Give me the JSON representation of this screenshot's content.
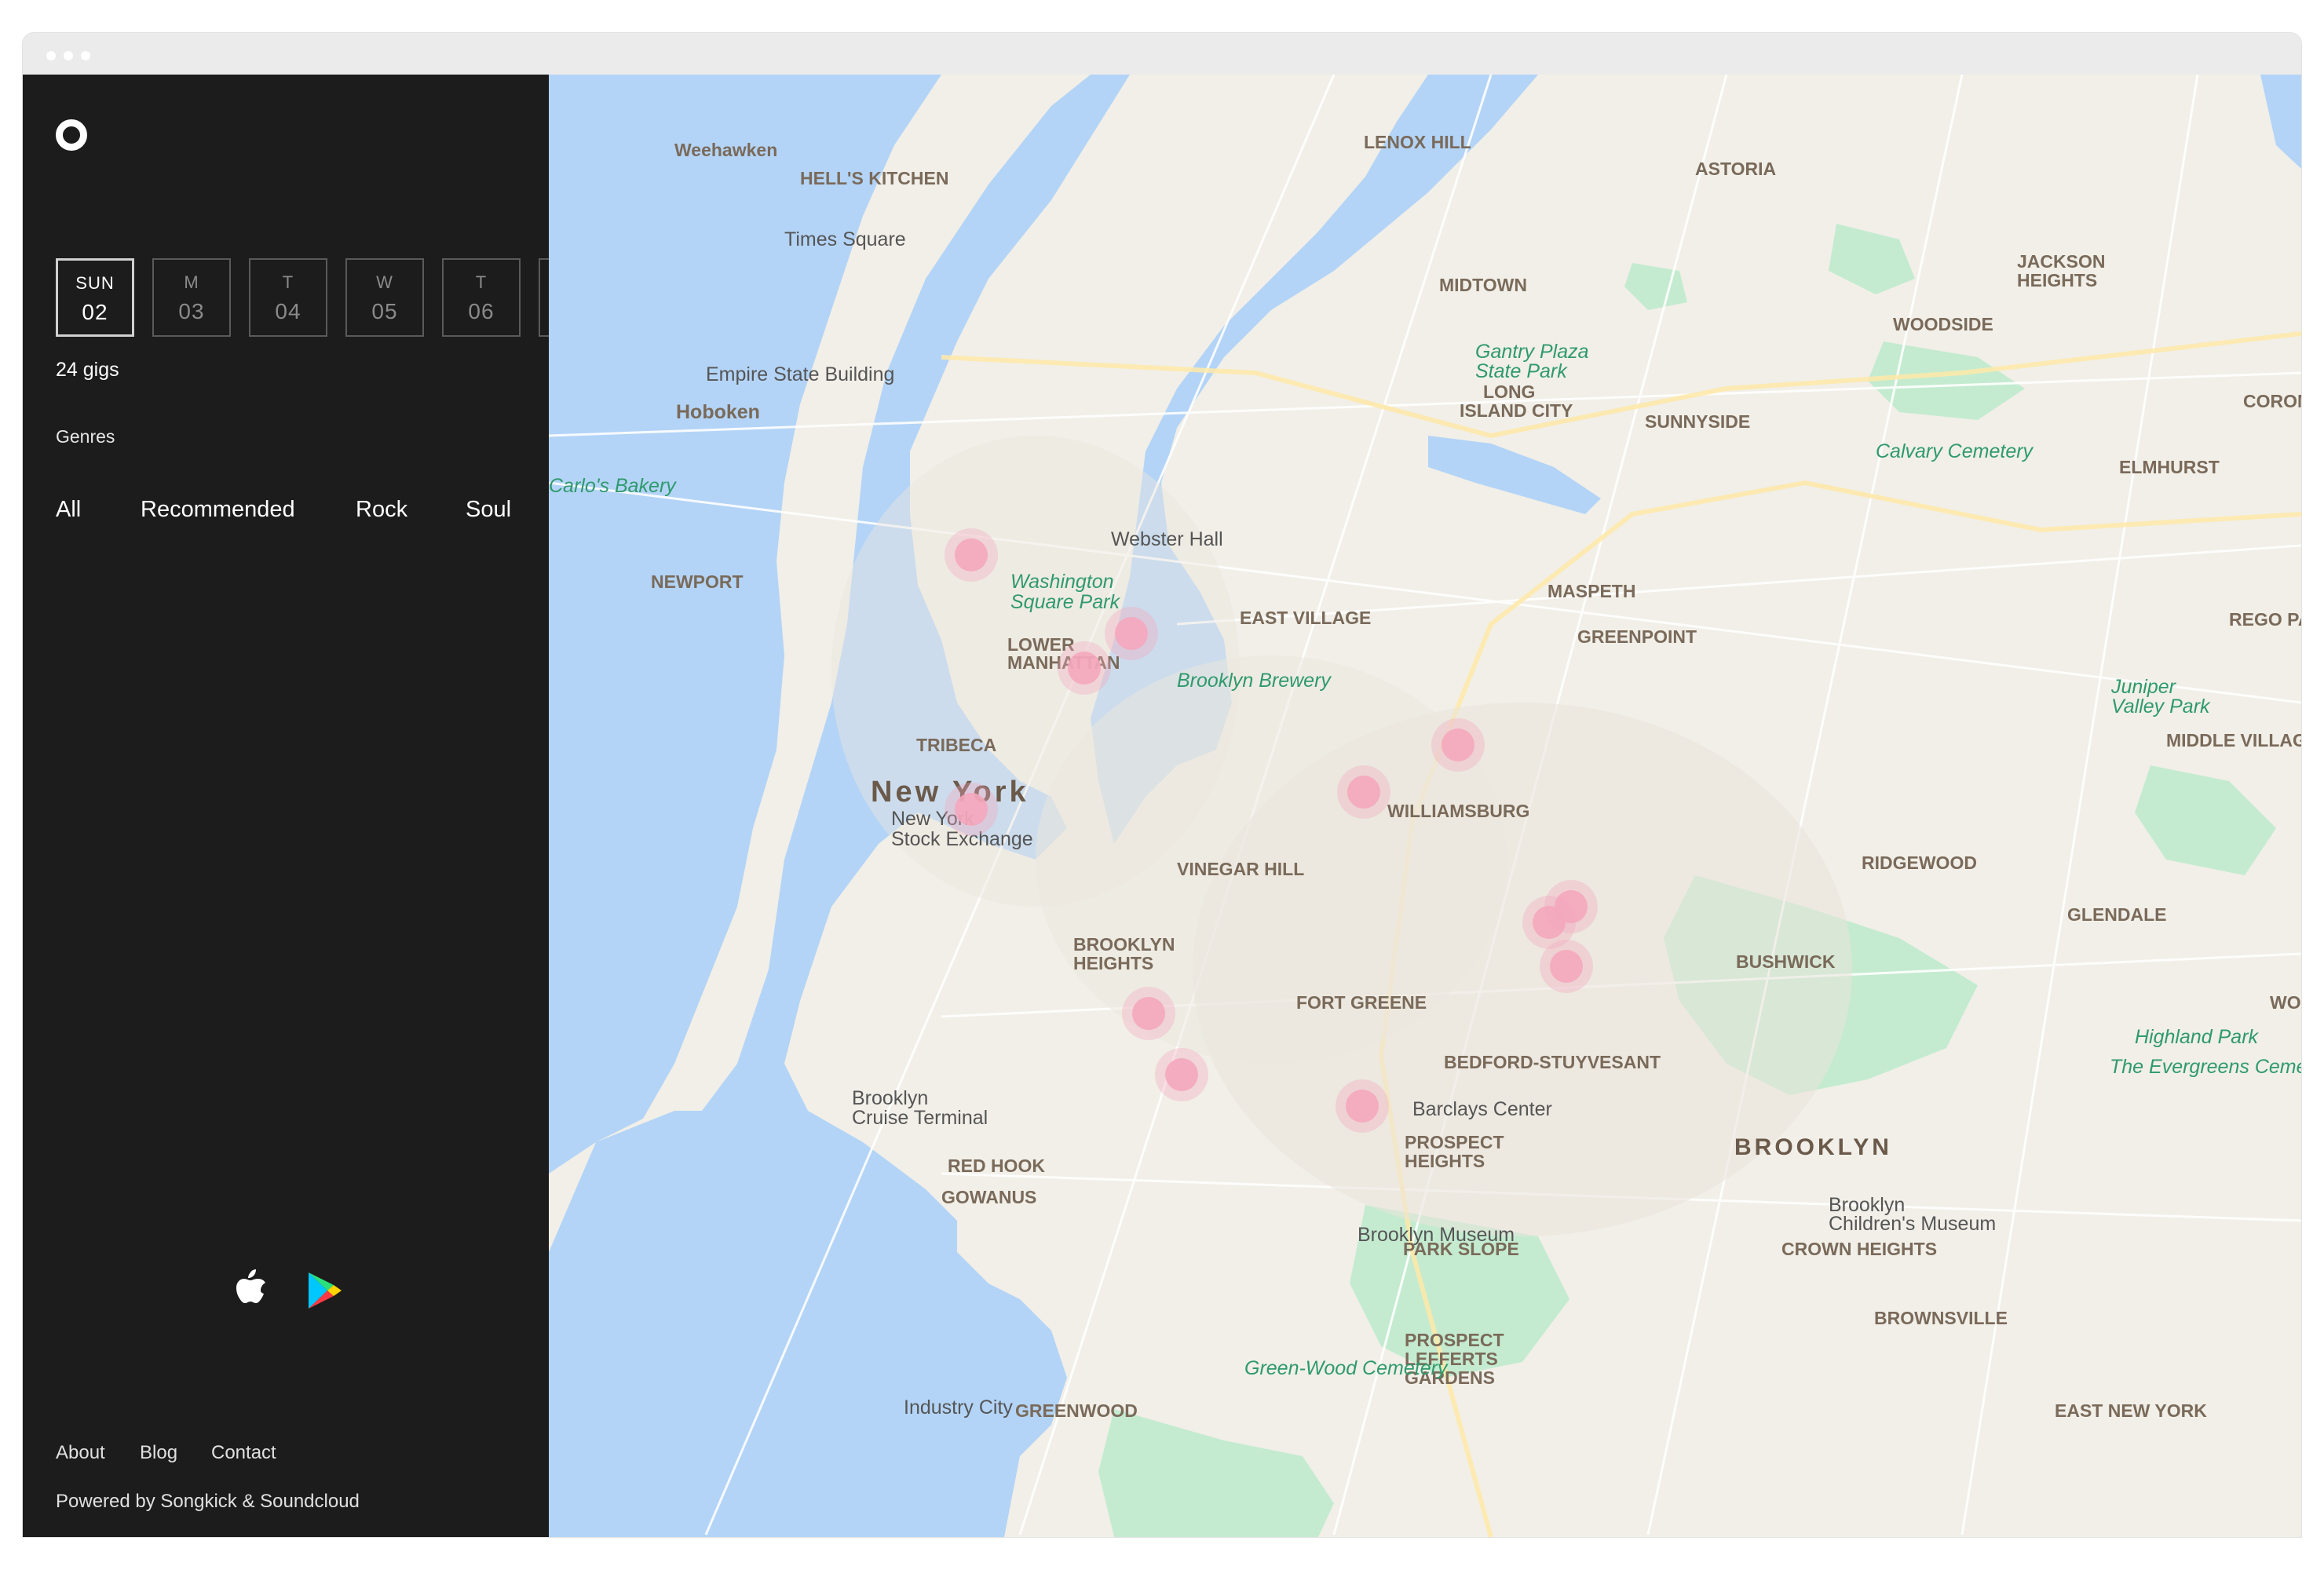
{
  "window": {
    "title": ""
  },
  "sidebar": {
    "days": [
      {
        "name": "SUN",
        "date": "02",
        "active": true
      },
      {
        "name": "M",
        "date": "03",
        "active": false
      },
      {
        "name": "T",
        "date": "04",
        "active": false
      },
      {
        "name": "W",
        "date": "05",
        "active": false
      },
      {
        "name": "T",
        "date": "06",
        "active": false
      }
    ],
    "gig_count": "24 gigs",
    "genres_label": "Genres",
    "genres": [
      "All",
      "Recommended",
      "Rock",
      "Soul"
    ],
    "footer_links": [
      "About",
      "Blog",
      "Contact"
    ],
    "powered_by": "Powered by Songkick & Soundcloud"
  },
  "map": {
    "colors": {
      "water": "#b3d4f7",
      "land": "#f1efe8",
      "park": "#c4ebd0",
      "marker": "#f4a7bd",
      "sidebar": "#1c1c1c"
    },
    "labels": [
      {
        "text": "Weehawken",
        "kind": "area"
      },
      {
        "text": "HELL'S KITCHEN",
        "kind": "area"
      },
      {
        "text": "LENOX HILL",
        "kind": "area"
      },
      {
        "text": "ASTORIA",
        "kind": "area"
      },
      {
        "text": "Times Square",
        "kind": "poi"
      },
      {
        "text": "MIDTOWN",
        "kind": "area"
      },
      {
        "text": "JACKSON",
        "kind": "area"
      },
      {
        "text": "HEIGHTS",
        "kind": "area"
      },
      {
        "text": "WOODSIDE",
        "kind": "area"
      },
      {
        "text": "Empire State Building",
        "kind": "poi"
      },
      {
        "text": "Gantry Plaza",
        "kind": "park"
      },
      {
        "text": "State Park",
        "kind": "park"
      },
      {
        "text": "LONG",
        "kind": "area"
      },
      {
        "text": "ISLAND CITY",
        "kind": "area"
      },
      {
        "text": "SUNNYSIDE",
        "kind": "area"
      },
      {
        "text": "CORONA",
        "kind": "area"
      },
      {
        "text": "Hoboken",
        "kind": "area"
      },
      {
        "text": "Calvary Cemetery",
        "kind": "park"
      },
      {
        "text": "ELMHURST",
        "kind": "area"
      },
      {
        "text": "Carlo's Bakery",
        "kind": "park"
      },
      {
        "text": "Webster Hall",
        "kind": "poi"
      },
      {
        "text": "Washington",
        "kind": "park"
      },
      {
        "text": "Square Park",
        "kind": "park"
      },
      {
        "text": "NEWPORT",
        "kind": "area"
      },
      {
        "text": "MASPETH",
        "kind": "area"
      },
      {
        "text": "EAST VILLAGE",
        "kind": "area"
      },
      {
        "text": "REGO PAR",
        "kind": "area"
      },
      {
        "text": "GREENPOINT",
        "kind": "area"
      },
      {
        "text": "LOWER",
        "kind": "area"
      },
      {
        "text": "MANHATTAN",
        "kind": "area"
      },
      {
        "text": "Brooklyn Brewery",
        "kind": "park"
      },
      {
        "text": "Juniper",
        "kind": "park"
      },
      {
        "text": "Valley Park",
        "kind": "park"
      },
      {
        "text": "MIDDLE VILLAGE",
        "kind": "area"
      },
      {
        "text": "TRIBECA",
        "kind": "area"
      },
      {
        "text": "New York",
        "kind": "city"
      },
      {
        "text": "WILLIAMSBURG",
        "kind": "area"
      },
      {
        "text": "New York",
        "kind": "poi"
      },
      {
        "text": "Stock Exchange",
        "kind": "poi"
      },
      {
        "text": "RIDGEWOOD",
        "kind": "area"
      },
      {
        "text": "VINEGAR HILL",
        "kind": "area"
      },
      {
        "text": "GLENDALE",
        "kind": "area"
      },
      {
        "text": "BROOKLYN",
        "kind": "area"
      },
      {
        "text": "HEIGHTS",
        "kind": "area"
      },
      {
        "text": "BUSHWICK",
        "kind": "area"
      },
      {
        "text": "FORT GREENE",
        "kind": "area"
      },
      {
        "text": "WOO",
        "kind": "area"
      },
      {
        "text": "Highland Park",
        "kind": "park"
      },
      {
        "text": "BEDFORD-STUYVESANT",
        "kind": "area"
      },
      {
        "text": "The Evergreens Cemetery",
        "kind": "park"
      },
      {
        "text": "Brooklyn",
        "kind": "poi"
      },
      {
        "text": "Cruise Terminal",
        "kind": "poi"
      },
      {
        "text": "Barclays Center",
        "kind": "poi"
      },
      {
        "text": "PROSPECT",
        "kind": "area"
      },
      {
        "text": "HEIGHTS",
        "kind": "area"
      },
      {
        "text": "BROOKLYN",
        "kind": "borough"
      },
      {
        "text": "RED HOOK",
        "kind": "area"
      },
      {
        "text": "Brooklyn",
        "kind": "poi"
      },
      {
        "text": "Children's Museum",
        "kind": "poi"
      },
      {
        "text": "GOWANUS",
        "kind": "area"
      },
      {
        "text": "Brooklyn Museum",
        "kind": "poi"
      },
      {
        "text": "PARK SLOPE",
        "kind": "area"
      },
      {
        "text": "CROWN HEIGHTS",
        "kind": "area"
      },
      {
        "text": "BROWNSVILLE",
        "kind": "area"
      },
      {
        "text": "PROSPECT",
        "kind": "area"
      },
      {
        "text": "LEFFERTS",
        "kind": "area"
      },
      {
        "text": "GARDENS",
        "kind": "area"
      },
      {
        "text": "Green-Wood Cemetery",
        "kind": "park"
      },
      {
        "text": "EAST NEW YORK",
        "kind": "area"
      },
      {
        "text": "Industry City",
        "kind": "poi"
      },
      {
        "text": "GREENWOOD",
        "kind": "area"
      }
    ],
    "gig_markers": [
      {
        "venue": "gig-marker-washington-square"
      },
      {
        "venue": "gig-marker-east-village"
      },
      {
        "venue": "gig-marker-lower-east-side"
      },
      {
        "venue": "gig-marker-financial-district"
      },
      {
        "venue": "gig-marker-williamsburg-north"
      },
      {
        "venue": "gig-marker-williamsburg-south"
      },
      {
        "venue": "gig-marker-bushwick-1"
      },
      {
        "venue": "gig-marker-bushwick-2"
      },
      {
        "venue": "gig-marker-bushwick-3"
      },
      {
        "venue": "gig-marker-fort-greene"
      },
      {
        "venue": "gig-marker-barclays"
      },
      {
        "venue": "gig-marker-crown-heights"
      }
    ]
  }
}
